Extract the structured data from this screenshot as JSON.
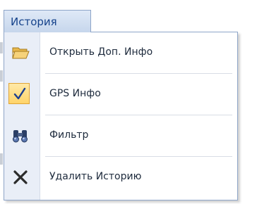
{
  "menu": {
    "title": "История",
    "items": [
      {
        "label": "Открыть Доп. Инфо",
        "icon": "folder-open-icon"
      },
      {
        "label": "GPS Инфо",
        "icon": "checkmark-icon",
        "checked": true
      },
      {
        "label": "Фильтр",
        "icon": "binoculars-icon"
      },
      {
        "label": "Удалить Историю",
        "icon": "delete-x-icon"
      }
    ]
  },
  "colors": {
    "tab_text": "#15428b",
    "menu_border": "#8ea5c8",
    "icon_column": "#e9eef7",
    "check_highlight": "#ffd46a"
  }
}
